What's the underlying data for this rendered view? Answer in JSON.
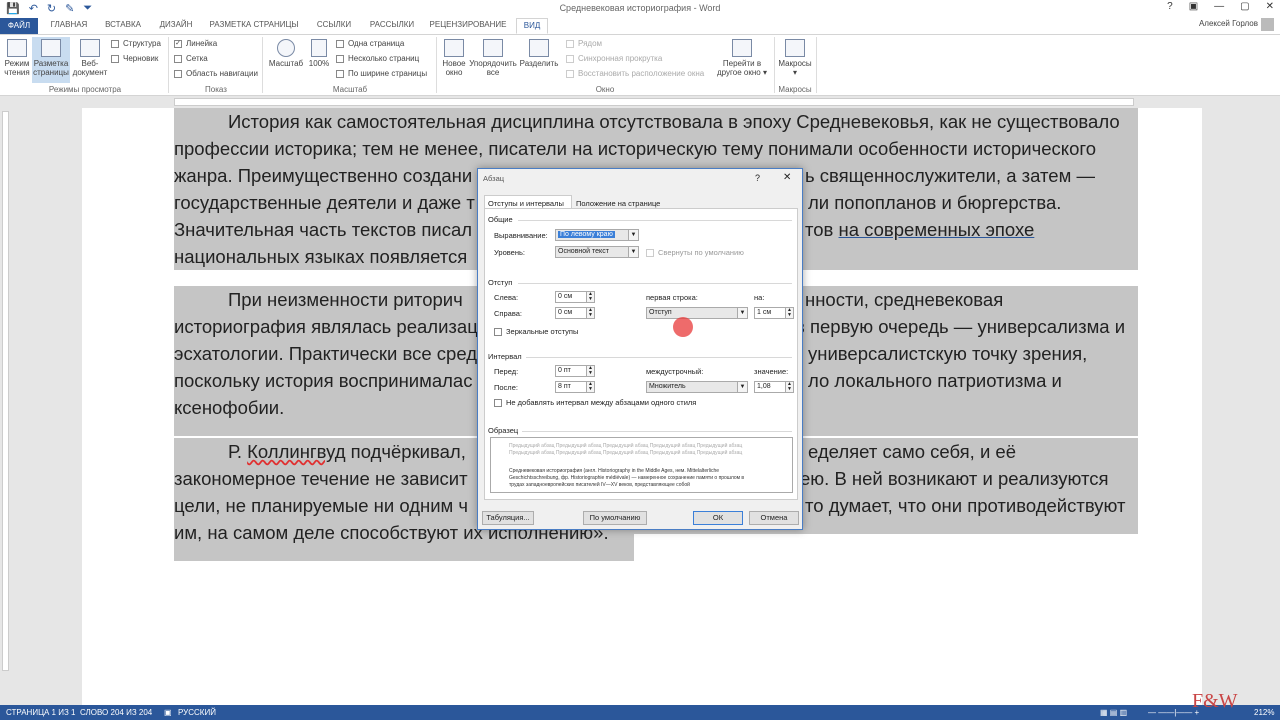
{
  "window": {
    "title": "Средневековая историография - Word",
    "user": "Алексей Горлов",
    "controls": [
      "?",
      "▣",
      "—",
      "▢",
      "✕"
    ]
  },
  "qat": [
    "💾",
    "↶",
    "↻",
    "✎",
    "⏷"
  ],
  "tabs": [
    "ФАЙЛ",
    "ГЛАВНАЯ",
    "ВСТАВКА",
    "ДИЗАЙН",
    "РАЗМЕТКА СТРАНИЦЫ",
    "ССЫЛКИ",
    "РАССЫЛКИ",
    "РЕЦЕНЗИРОВАНИЕ",
    "ВИД"
  ],
  "ribbon": {
    "views": {
      "label": "Режимы просмотра",
      "read": [
        "Режим",
        "чтения"
      ],
      "layout": [
        "Разметка",
        "страницы"
      ],
      "web": [
        "Веб-",
        "документ"
      ],
      "outline": "Структура",
      "draft": "Черновик"
    },
    "show": {
      "label": "Показ",
      "ruler": "Линейка",
      "grid": "Сетка",
      "nav": "Область навигации"
    },
    "zoom": {
      "label": "Масштаб",
      "zoom": "Масштаб",
      "p100": "100%",
      "one": "Одна страница",
      "multi": "Несколько страниц",
      "width": "По ширине страницы"
    },
    "window": {
      "label": "Окно",
      "new": [
        "Новое",
        "окно"
      ],
      "arrange": [
        "Упорядочить",
        "все"
      ],
      "split": "Разделить",
      "side": "Рядом",
      "sync": "Синхронная прокрутка",
      "reset": "Восстановить расположение окна",
      "switch": [
        "Перейти в",
        "другое окно ▾"
      ]
    },
    "macros": {
      "label": "Макросы",
      "btn": [
        "Макросы",
        "▾"
      ]
    }
  },
  "doc": {
    "l1": "История как самостоятельная дисциплина отсутствовала в эпоху Средневековья, как не существовало",
    "l2": "профессии историка; тем не менее, писатели на историческую тему понимали особенности исторического",
    "l3a": "жанра. Преимущественно создани",
    "l3b": "ь священнослужители, а затем —",
    "l4a": "государственные деятели и даже т",
    "l4b": "ли попопланов и бюргерства.",
    "l5a": "Значительная часть текстов писал",
    "l5b": "тов",
    "l5c": "на современных эпохе",
    "l6a": "национальных языках появляется",
    "l7a": "При неизменности риторич",
    "l7b": "нности, средневековая",
    "l8a": "историография являлась реализац",
    "l8b": "в первую очередь — универсализма и",
    "l9a": "эсхатологии. Практически все сред",
    "l9b": "универсалистскую точку зрения,",
    "l10a": "поскольку история воспринималас",
    "l10b": "ло локального патриотизма и",
    "l11": "ксенофобии.",
    "l12a": "Р.",
    "l12b": "Коллингвуд",
    "l12c": "подчёркивал,",
    "l12d": "еделяет само себя, и её",
    "l13a": "закономерное течение не зависит",
    "l13b": "ею. В ней возникают и реализуются",
    "l14a": "цели, не планируемые ни одним ч",
    "l14b": "то думает, что они противодействуют",
    "l15": "им, на самом деле способствуют их исполнению»."
  },
  "dialog": {
    "title": "Абзац",
    "help": "?",
    "close": "✕",
    "tab1": "Отступы и интервалы",
    "tab2": "Положение на странице",
    "general": "Общие",
    "align_label": "Выравнивание:",
    "align_value": "По левому краю",
    "level_label": "Уровень:",
    "level_value": "Основной текст",
    "collapsed": "Свернуты по умолчанию",
    "indent": "Отступ",
    "left_label": "Слева:",
    "left_value": "0 см",
    "right_label": "Справа:",
    "right_value": "0 см",
    "first_label": "первая строка:",
    "first_value": "Отступ",
    "on_label": "на:",
    "on_value": "1 см",
    "mirror": "Зеркальные отступы",
    "spacing": "Интервал",
    "before_label": "Перед:",
    "before_value": "0 пт",
    "after_label": "После:",
    "after_value": "8 пт",
    "line_label": "междустрочный:",
    "line_value": "Множитель",
    "val_label": "значение:",
    "val_value": "1,08",
    "nospace": "Не добавлять интервал между абзацами одного стиля",
    "sample": "Образец",
    "sample_prev": "Предыдущий абзац Предыдущий абзац Предыдущий абзац Предыдущий абзац Предыдущий абзац Предыдущий абзац Предыдущий абзац Предыдущий абзац Предыдущий абзац Предыдущий абзац",
    "sample_text": "Средневековая историография (англ. Historiography in the Middle Ages, нем. Mittelalterliche Geschichtsschreibung, фр. Historiographie médiévale) — намеренное сохранение памяти о прошлом в трудах западноевропейских писателей IV—XV веков, представляющее собой",
    "tabs_btn": "Табуляция...",
    "default_btn": "По умолчанию",
    "ok": "ОК",
    "cancel": "Отмена"
  },
  "status": {
    "page": "СТРАНИЦА 1 ИЗ 1",
    "words": "СЛОВО 204 ИЗ 204",
    "lang": "РУССКИЙ",
    "zoom": "212%"
  },
  "logo": "F&W"
}
